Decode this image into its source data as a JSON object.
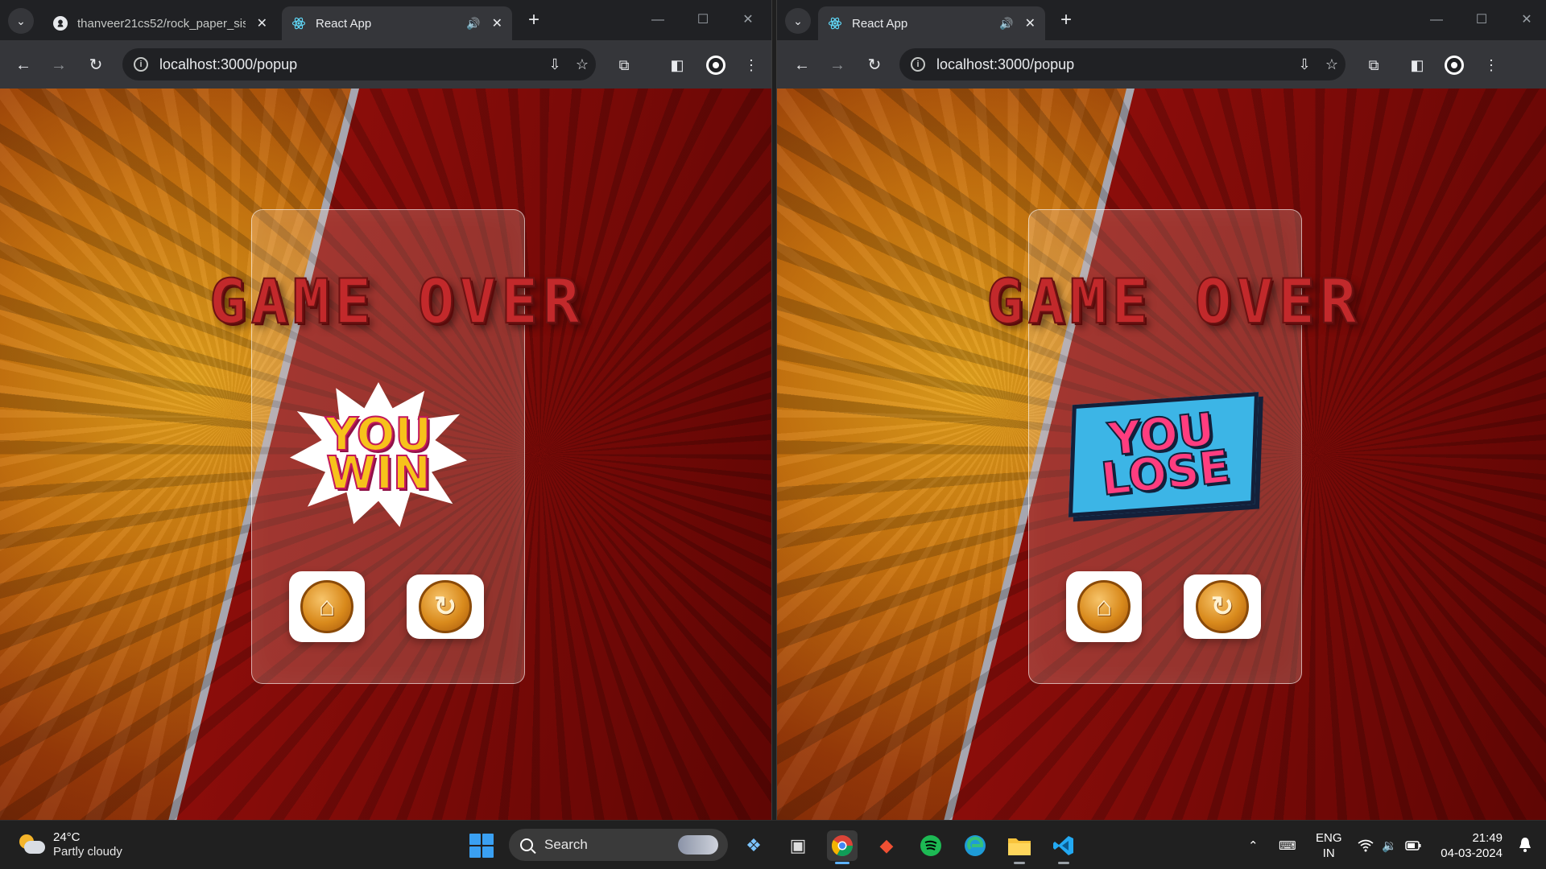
{
  "left_window": {
    "tabs": [
      {
        "title": "thanveer21cs52/rock_paper_sis",
        "active": false
      },
      {
        "title": "React App",
        "active": true
      }
    ],
    "url": "localhost:3000/popup",
    "page": {
      "heading": "GAME OVER",
      "result_line1": "YOU",
      "result_line2": "WIN",
      "home_label": "⌂",
      "replay_label": "↻"
    }
  },
  "right_window": {
    "tabs": [
      {
        "title": "React App",
        "active": true
      }
    ],
    "url": "localhost:3000/popup",
    "page": {
      "heading": "GAME OVER",
      "result_line1": "YOU",
      "result_line2": "LOSE",
      "home_label": "⌂",
      "replay_label": "↻"
    }
  },
  "taskbar": {
    "weather": {
      "temp": "24°C",
      "desc": "Partly cloudy"
    },
    "search_placeholder": "Search",
    "apps": [
      "widgets-icon",
      "task-view-icon",
      "chrome-icon",
      "git-icon",
      "spotify-icon",
      "edge-icon",
      "file-explorer-icon",
      "vscode-icon"
    ],
    "language": {
      "line1": "ENG",
      "line2": "IN"
    },
    "time": "21:49",
    "date": "04-03-2024"
  },
  "colors": {
    "chrome_dark": "#202124",
    "chrome_toolbar": "#35363a",
    "game_over_red": "#c2292b",
    "coin_orange": "#d98a1c",
    "taskbar": "#202020"
  }
}
